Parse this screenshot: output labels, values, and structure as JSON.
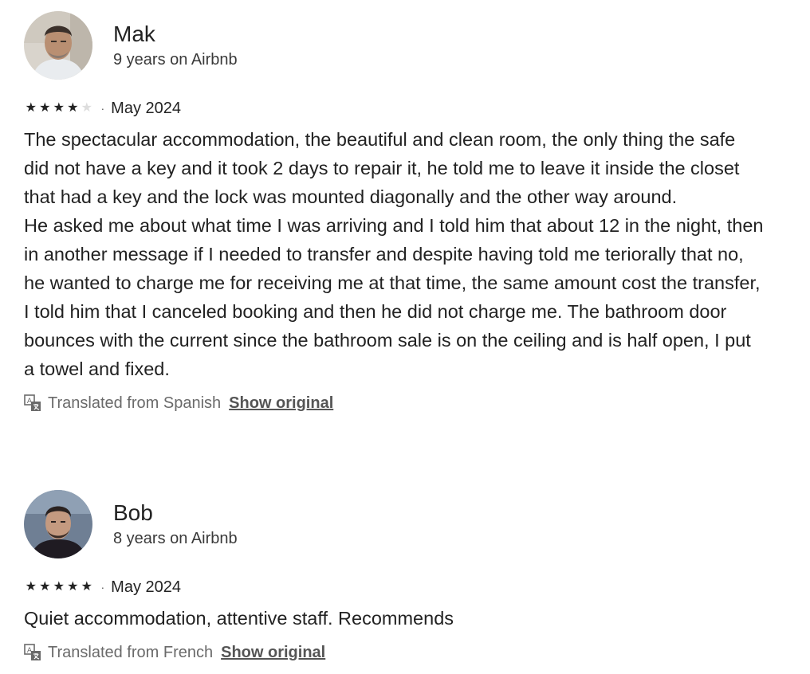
{
  "reviews": [
    {
      "name": "Mak",
      "tenure": "9 years on Airbnb",
      "rating": 4,
      "rating_max": 5,
      "separator": "·",
      "date": "May 2024",
      "paragraphs": [
        "The spectacular accommodation, the beautiful and clean room, the only thing the safe did not have a key and it took 2 days to repair it, he told me to leave it inside the closet that had a key and the lock was mounted diagonally and the other way around.",
        "He asked me about what time I was arriving and I told him that about 12 in the night, then in another message if I needed to transfer and despite having told me teriorally that no, he wanted to charge me for receiving me at that time, the same amount cost the transfer, I told him that I canceled booking and then he did not charge me. The bathroom door bounces with the current since the bathroom sale is on the ceiling and is half open, I put a towel and fixed."
      ],
      "translation_note": "Translated from Spanish",
      "show_original_label": "Show original",
      "avatar_icon": "user-photo-avatar"
    },
    {
      "name": "Bob",
      "tenure": "8 years on Airbnb",
      "rating": 5,
      "rating_max": 5,
      "separator": "·",
      "date": "May 2024",
      "paragraphs": [
        "Quiet accommodation, attentive staff. Recommends"
      ],
      "translation_note": "Translated from French",
      "show_original_label": "Show original",
      "avatar_icon": "user-photo-avatar"
    }
  ],
  "icons": {
    "star": "star-icon",
    "translate": "translate-icon"
  },
  "colors": {
    "text": "#222222",
    "muted": "#6a6a6a",
    "star_filled": "#222222",
    "star_empty": "#dddddd"
  }
}
